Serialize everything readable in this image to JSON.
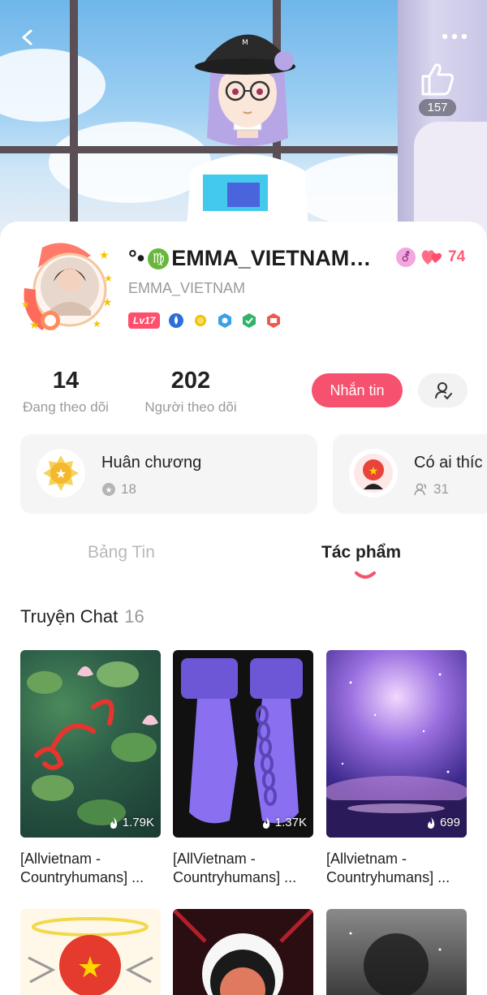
{
  "header": {
    "like_count": "157"
  },
  "profile": {
    "name_prefix": "°•",
    "zodiac_glyph": "♍",
    "name": "EMMA_VIETNAM…",
    "handle": "EMMA_VIETNAM",
    "gender_glyph": "⚦",
    "heart_count": "74",
    "level": "Lv17"
  },
  "stats": {
    "following_count": "14",
    "following_label": "Đang theo dõi",
    "followers_count": "202",
    "followers_label": "Người theo dõi",
    "message_button": "Nhắn tin"
  },
  "info_cards": [
    {
      "title": "Huân chương",
      "value": "18"
    },
    {
      "title": "Có ai thíc",
      "value": "31"
    }
  ],
  "tabs": {
    "feed": "Bảng Tin",
    "works": "Tác phẩm",
    "active": "works"
  },
  "section": {
    "title": "Truyện Chat",
    "count": "16"
  },
  "stories": [
    {
      "views": "1.79K",
      "title_line1": "[Allvietnam -",
      "title_line2": "Countryhumans] ..."
    },
    {
      "views": "1.37K",
      "title_line1": "[AllVietnam -",
      "title_line2": "Countryhumans] ..."
    },
    {
      "views": "699",
      "title_line1": "[Allvietnam -",
      "title_line2": "Countryhumans] ..."
    }
  ],
  "colors": {
    "accent": "#f6516e",
    "muted_text": "#9a9a9a"
  }
}
